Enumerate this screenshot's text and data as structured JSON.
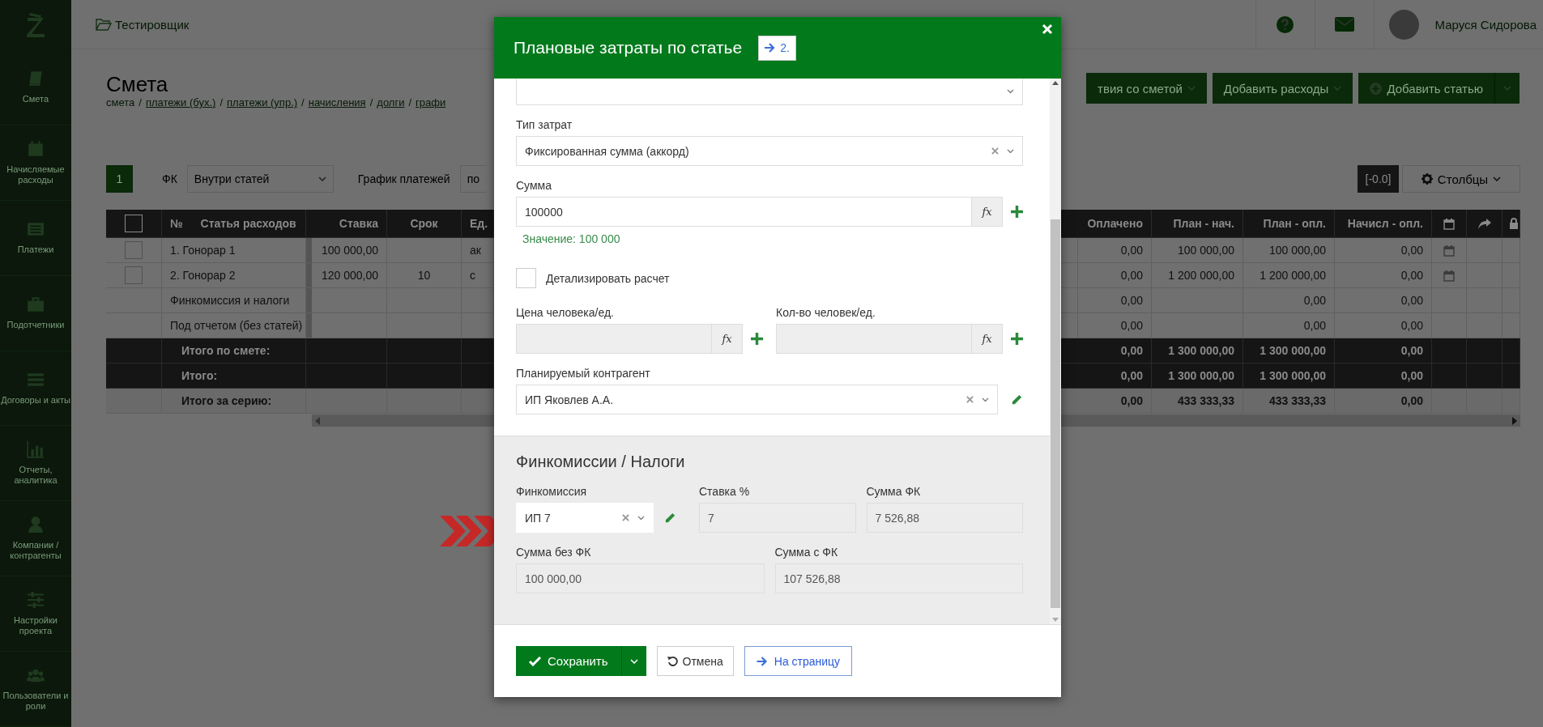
{
  "sidebar": {
    "items": [
      "Смета",
      "Начисляемые расходы",
      "Платежи",
      "Подотчетники",
      "Договоры и акты",
      "Отчеты, аналитика",
      "Компании / контрагенты",
      "Настройки проекта",
      "Пользователи и роли"
    ]
  },
  "topbar": {
    "project": "Тестировщик",
    "user": "Маруся Сидорова"
  },
  "page": {
    "title": "Смета",
    "breadcrumb": [
      {
        "kind": "text",
        "label": "смета"
      },
      {
        "kind": "separator",
        "label": "/"
      },
      {
        "kind": "link",
        "label": "платежи (бух.)"
      },
      {
        "kind": "separator",
        "label": "/"
      },
      {
        "kind": "link",
        "label": "платежи (упр.)"
      },
      {
        "kind": "separator",
        "label": "/"
      },
      {
        "kind": "link",
        "label": "начисления"
      },
      {
        "kind": "separator",
        "label": "/"
      },
      {
        "kind": "link",
        "label": "долги"
      },
      {
        "kind": "separator",
        "label": "/"
      },
      {
        "kind": "link",
        "label": "графи"
      }
    ]
  },
  "actions": [
    {
      "kind": "dropdown",
      "label": "твия со сметой"
    },
    {
      "kind": "dropdown",
      "label": "Добавить расходы"
    },
    {
      "kind": "split",
      "label": "Добавить статью"
    }
  ],
  "filters": {
    "page_badge": "1",
    "fc_label": "ФК",
    "fc_value": "Внутри статей",
    "schedule_label": "График платежей",
    "schedule_value": "по",
    "precision": "[-0.0]",
    "columns_button": "Столбцы"
  },
  "table": {
    "header_checkbox": {
      "checked": false
    },
    "columns_left": [
      "№",
      "Статья расходов",
      "Ставка",
      "Срок",
      "Ед."
    ],
    "columns_right": [
      "Оплачено",
      "План - нач.",
      "План - опл.",
      "Начисл - опл."
    ],
    "rows": [
      {
        "kind": "item",
        "checked": false,
        "name": "1. Гонорар 1",
        "rate": "100 000,00",
        "unit": "ак",
        "paid": "0,00",
        "plan_accrued": "100 000,00",
        "plan_paid": "100 000,00",
        "accrued_paid": "0,00",
        "calendar": true
      },
      {
        "kind": "item",
        "checked": false,
        "name": "2. Гонорар 2",
        "rate": "120 000,00",
        "term": "10",
        "unit": "с",
        "paid": "0,00",
        "plan_accrued": "1 200 000,00",
        "plan_paid": "1 200 000,00",
        "accrued_paid": "0,00",
        "calendar": true
      },
      {
        "kind": "service",
        "name": "Финкомиссия и налоги",
        "paid": "0,00",
        "plan_paid": "0,00",
        "accrued_paid": "0,00"
      },
      {
        "kind": "service",
        "name": "Под отчетом (без статей)",
        "paid": "0,00",
        "plan_paid": "0,00",
        "accrued_paid": "0,00"
      },
      {
        "kind": "total",
        "name": "Итого по смете:",
        "paid": "0,00",
        "plan_accrued": "1 300 000,00",
        "plan_paid": "1 300 000,00",
        "accrued_paid": "0,00"
      },
      {
        "kind": "total",
        "name": "Итого:",
        "paid": "0,00",
        "plan_accrued": "1 300 000,00",
        "plan_paid": "1 300 000,00",
        "accrued_paid": "0,00"
      },
      {
        "kind": "series",
        "name": "Итого за серию:",
        "paid": "0,00",
        "plan_accrued": "433 333,33",
        "plan_paid": "433 333,33",
        "accrued_paid": "0,00"
      }
    ]
  },
  "modal": {
    "title": "Плановые затраты по статье",
    "badge": "2.",
    "cost_type": {
      "label": "Тип затрат",
      "value": "Фиксированная сумма (аккорд)"
    },
    "amount": {
      "label": "Сумма",
      "value": "100000",
      "formula": "fx",
      "hint": "Значение: 100 000"
    },
    "detail": {
      "label": "Детализировать расчет",
      "checked": false
    },
    "price": {
      "label": "Цена человека/ед.",
      "formula": "fx",
      "disabled": true
    },
    "quantity": {
      "label": "Кол-во человек/ед.",
      "formula": "fx",
      "disabled": true
    },
    "contractor": {
      "label": "Планируемый контрагент",
      "value": "ИП Яковлев А.А."
    },
    "fees": {
      "title": "Финкомиссии / Налоги",
      "commission": {
        "label": "Финкомиссия",
        "value": "ИП 7"
      },
      "rate": {
        "label": "Ставка %",
        "value": "7",
        "disabled": true
      },
      "fee_sum": {
        "label": "Сумма ФК",
        "value": "7 526,88",
        "disabled": true
      },
      "sum_without": {
        "label": "Сумма без ФК",
        "value": "100 000,00",
        "disabled": true
      },
      "sum_with": {
        "label": "Сумма с ФК",
        "value": "107 526,88",
        "disabled": true
      }
    },
    "footer": {
      "save": "Сохранить",
      "cancel": "Отмена",
      "to_page": "На страницу"
    }
  }
}
